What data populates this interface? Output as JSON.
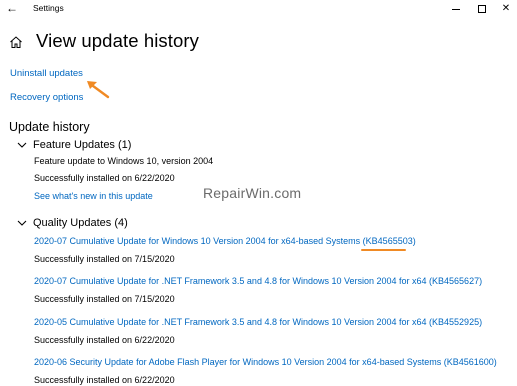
{
  "window": {
    "title": "Settings",
    "back_glyph": "←",
    "minimize_label": "",
    "maximize_label": "",
    "close_glyph": "✕"
  },
  "header": {
    "title": "View update history",
    "home_icon": "home-icon"
  },
  "links": {
    "uninstall": "Uninstall updates",
    "recovery": "Recovery options"
  },
  "section": {
    "title": "Update history"
  },
  "feature_group": {
    "label": "Feature Updates (1)",
    "items": [
      {
        "name": "Feature update to Windows 10, version 2004",
        "status": "Successfully installed on 6/22/2020",
        "extra_link": "See what's new in this update"
      }
    ]
  },
  "quality_group": {
    "label": "Quality Updates (4)",
    "items": [
      {
        "name": "2020-07 Cumulative Update for Windows 10 Version 2004 for x64-based Systems (KB4565503)",
        "status": "Successfully installed on 7/15/2020"
      },
      {
        "name": "2020-07 Cumulative Update for .NET Framework 3.5 and 4.8 for Windows 10 Version 2004 for x64 (KB4565627)",
        "status": "Successfully installed on 7/15/2020"
      },
      {
        "name": "2020-05 Cumulative Update for .NET Framework 3.5 and 4.8 for Windows 10 Version 2004 for x64 (KB4552925)",
        "status": "Successfully installed on 6/22/2020"
      },
      {
        "name": "2020-06 Security Update for Adobe Flash Player for Windows 10 Version 2004 for x64-based Systems (KB4561600)",
        "status": "Successfully installed on 6/22/2020"
      }
    ]
  },
  "watermark": "RepairWin.com",
  "colors": {
    "link": "#0067c0",
    "annotation": "#f08a24"
  }
}
